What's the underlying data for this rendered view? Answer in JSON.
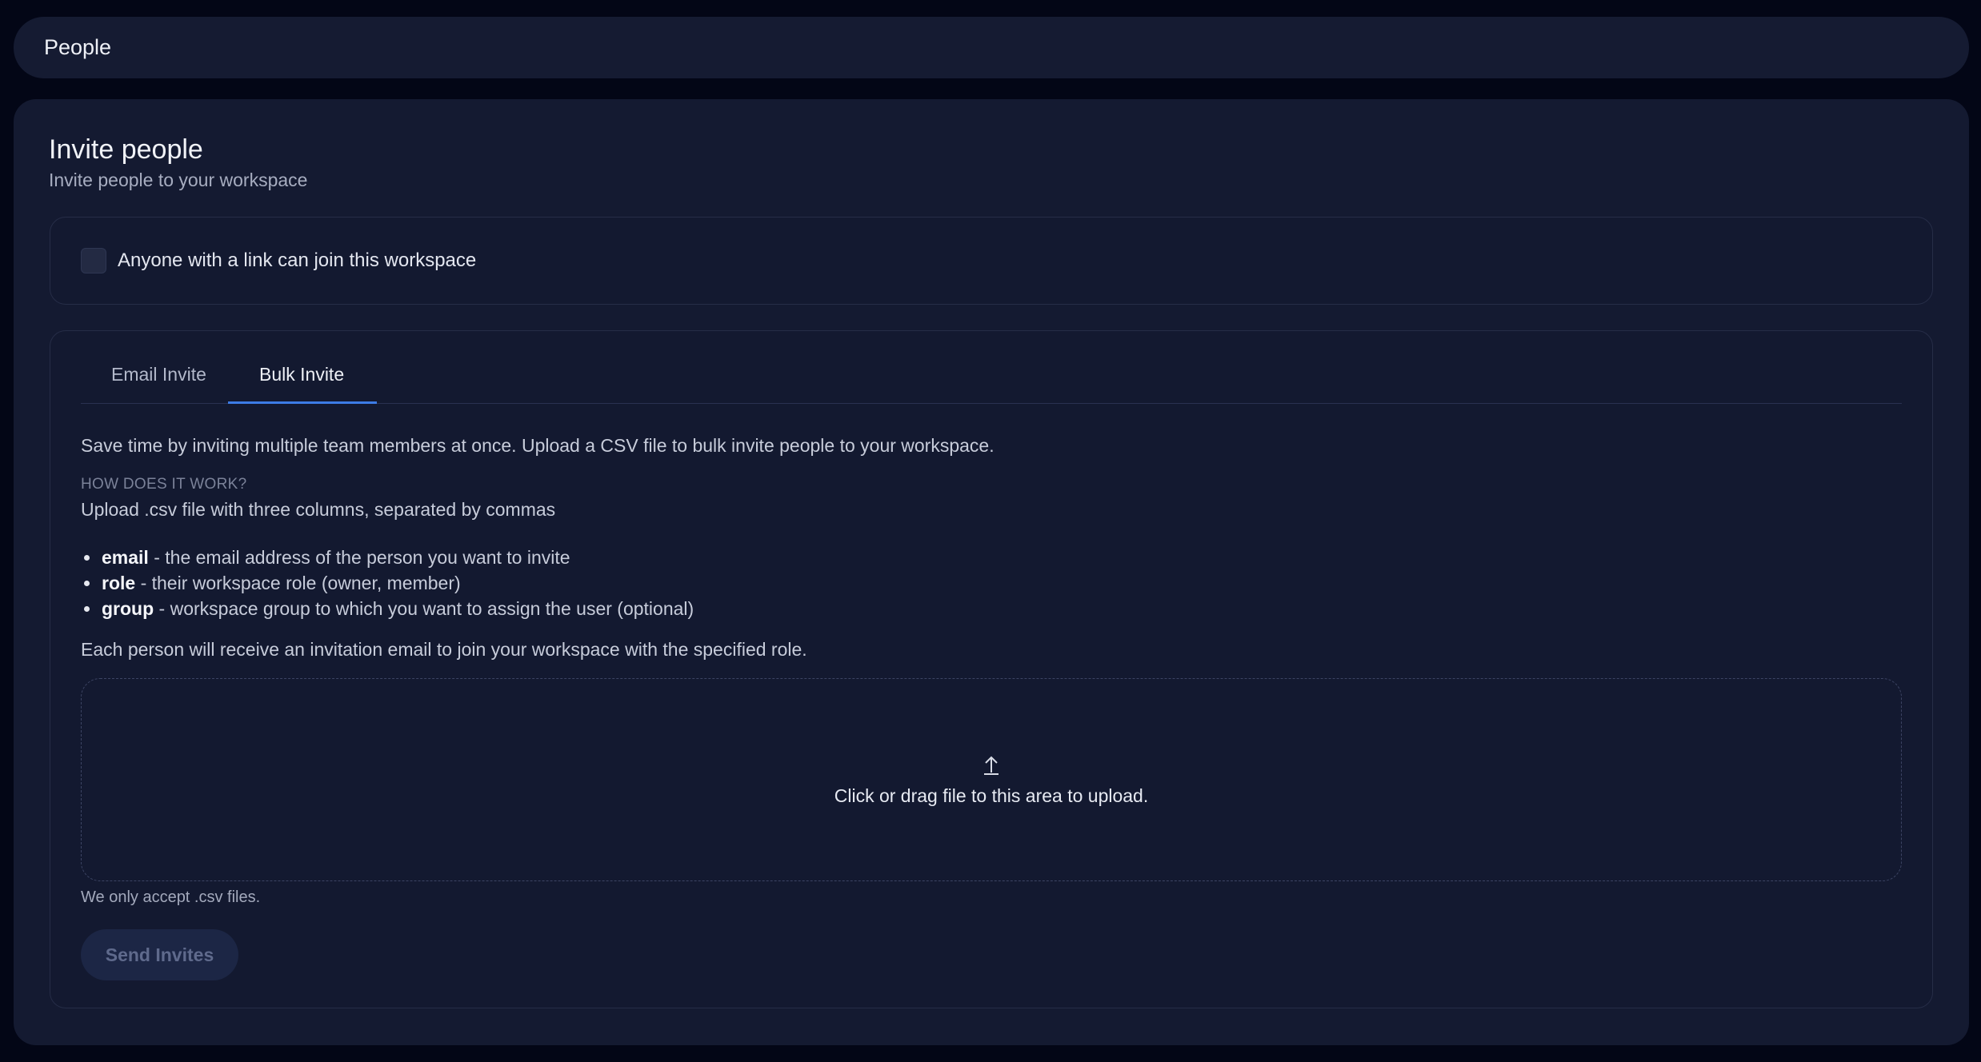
{
  "header": {
    "title": "People"
  },
  "invite": {
    "title": "Invite people",
    "subtitle": "Invite people to your workspace",
    "link_checkbox_label": "Anyone with a link can join this workspace",
    "tabs": [
      {
        "label": "Email Invite",
        "active": false
      },
      {
        "label": "Bulk Invite",
        "active": true
      }
    ],
    "bulk": {
      "description": "Save time by inviting multiple team members at once. Upload a CSV file to bulk invite people to your workspace.",
      "how_heading": "HOW DOES IT WORK?",
      "upload_note": "Upload .csv file with three columns, separated by commas",
      "columns": [
        {
          "name": "email",
          "text": " - the email address of the person you want to invite"
        },
        {
          "name": "role",
          "text": " - their workspace role (owner, member)"
        },
        {
          "name": "group",
          "text": " - workspace group to which you want to assign the user (optional)"
        }
      ],
      "each_note": "Each person will receive an invitation email to join your workspace with the specified role.",
      "dropzone_text": "Click or drag file to this area to upload.",
      "accept_note": "We only accept .csv files.",
      "send_label": "Send Invites"
    }
  },
  "colors": {
    "background": "#030616",
    "card": "#141a31",
    "accent": "#3d7ce6",
    "button_disabled_bg": "#1c2645"
  },
  "icons": {
    "upload": "upload-arrow-icon"
  }
}
